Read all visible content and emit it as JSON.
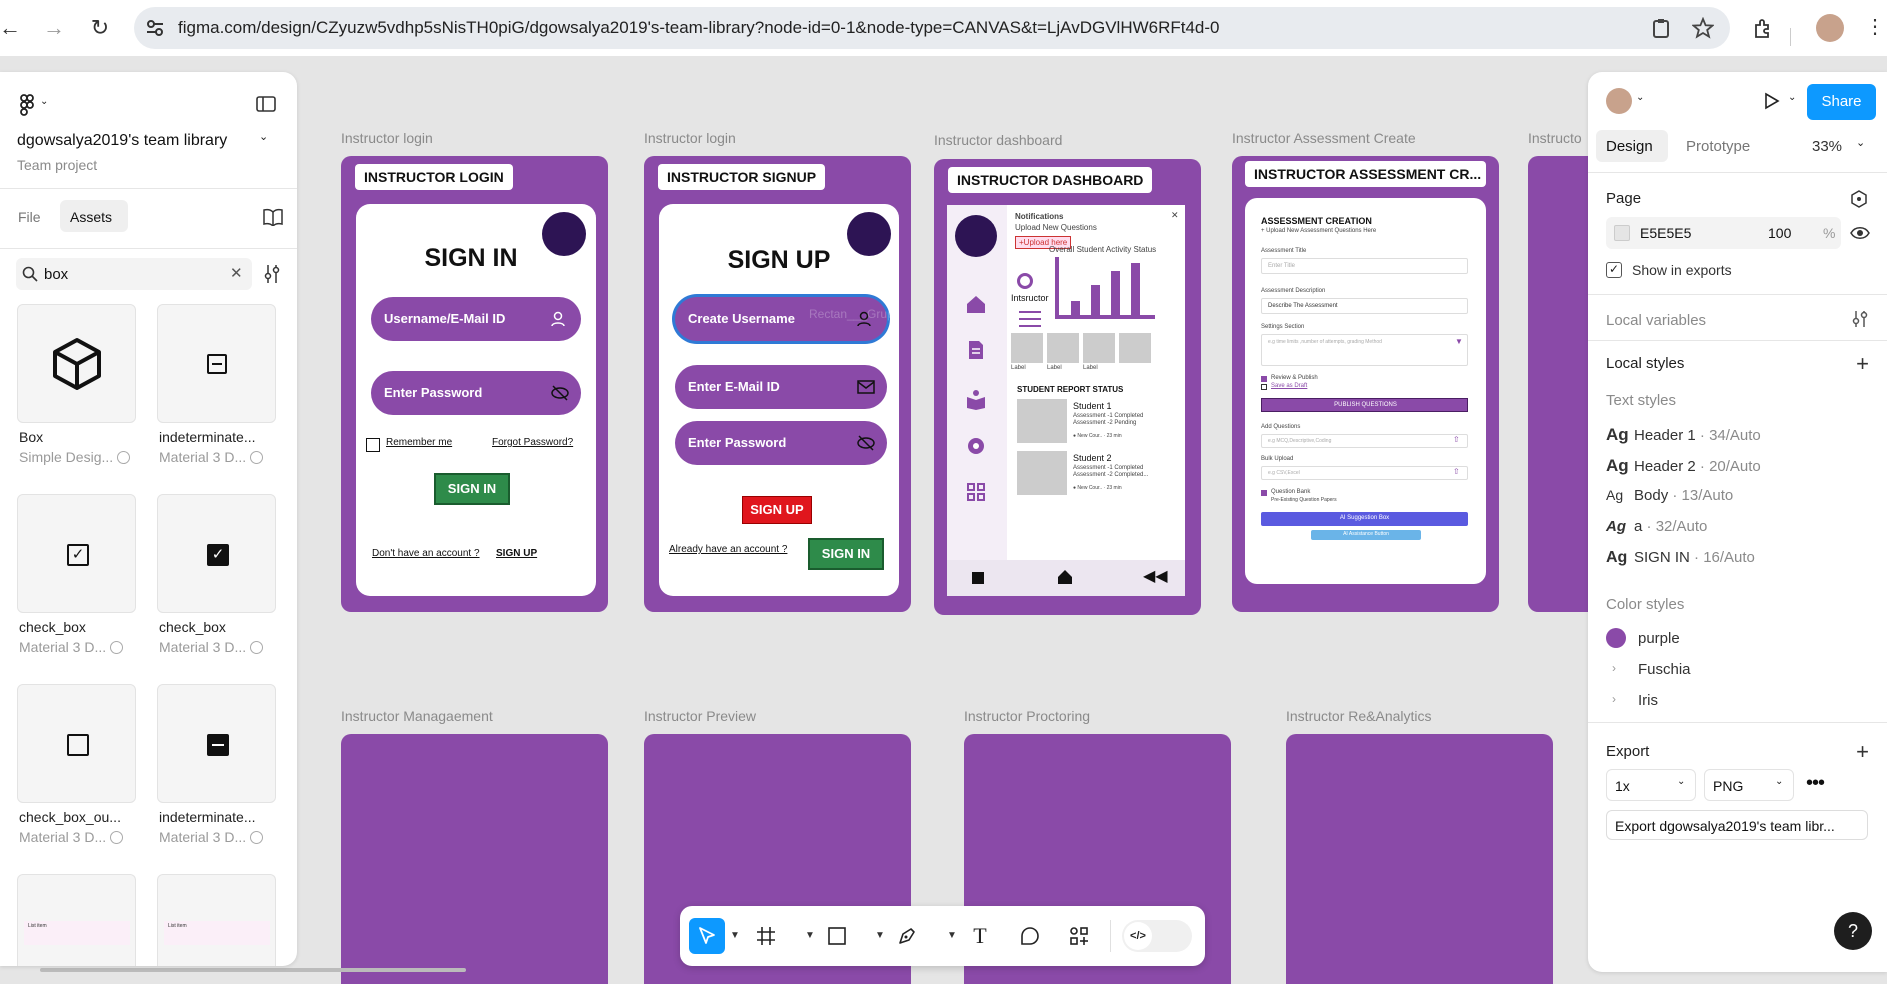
{
  "browser": {
    "url": "figma.com/design/CZyuzw5vdhp5sNisTH0piG/dgowsalya2019's-team-library?node-id=0-1&node-type=CANVAS&t=LjAvDGVlHW6RFt4d-0"
  },
  "left_panel": {
    "team_name": "dgowsalya2019's team library",
    "project_type": "Team project",
    "tabs": [
      "File",
      "Assets"
    ],
    "active_tab": "Assets",
    "search_value": "box",
    "assets": [
      {
        "name": "Box",
        "source": "Simple Desig..."
      },
      {
        "name": "indeterminate...",
        "source": "Material 3 D..."
      },
      {
        "name": "check_box",
        "source": "Material 3 D..."
      },
      {
        "name": "check_box",
        "source": "Material 3 D..."
      },
      {
        "name": "check_box_ou...",
        "source": "Material 3 D..."
      },
      {
        "name": "indeterminate...",
        "source": "Material 3 D..."
      }
    ],
    "list_item_thumb": "List item"
  },
  "canvas": {
    "frame_labels": [
      "Instructor login",
      "Instructor login",
      "Instructor dashboard",
      "Instructor Assessment  Create",
      "Instructo",
      "Instructor Managaement",
      "Instructor Preview",
      "Instructor Proctoring",
      "Instructor Re&Analytics"
    ],
    "login": {
      "title": "INSTRUCTOR LOGIN",
      "heading": "SIGN IN",
      "username": "Username/E-Mail ID",
      "password": "Enter Password",
      "remember": "Remember me",
      "forgot": "Forgot Password?",
      "signin": "SIGN IN",
      "no_account": "Don't have an account ?",
      "signup_link": "SIGN UP"
    },
    "signup": {
      "title": "INSTRUCTOR SIGNUP",
      "heading": "SIGN UP",
      "username": "Create Username",
      "email": "Enter E-Mail ID",
      "password": "Enter Password",
      "signup_btn": "SIGN UP",
      "already": "Already have an account ?",
      "signin_btn": "SIGN IN",
      "ghost": "Rectan___Grup"
    },
    "dashboard": {
      "title": "INSTRUCTOR DASHBOARD",
      "notifications": "Notifications",
      "upload_new": "Upload New Questions",
      "upload_btn": "+Upload here",
      "role": "Intsructor",
      "chart_title": "Overall Student  Activity Status",
      "label": "Label",
      "report_title": "STUDENT REPORT STATUS",
      "student1": "Student 1",
      "s1_line1": "Assessment -1 Completed",
      "s1_line2": "Assessment -2 Pending",
      "student2": "Student 2",
      "s2_line1": "Assessment -1 Completed",
      "s2_line2": "Assessment -2 Completed...",
      "new_course": "New Cour..",
      "mins": "23 min"
    },
    "assessment": {
      "title": "INSTRUCTOR ASSESSMENT CR...",
      "heading": "ASSESSMENT  CREATION",
      "subheading": "+ Upload New Assessment Questions Here",
      "f1_label": "Assessment Title",
      "f1_ph": "Enter Title",
      "f2_label": "Assessment Description",
      "f2_val": "Describe The Assessment",
      "f3_label": "Settings Section",
      "f3_ph": "e.g time limits ,number of attempts, grading Method",
      "review": "Review & Publish",
      "draft": "Save as Draft",
      "publish": "PUBLISH QUESTIONS",
      "add_q": "Add Questions",
      "add_q_ph": "e.g MCQ,Descriptive,Coding",
      "bulk": "Bulk Upload",
      "bulk_ph": "e.g CSV,Excel",
      "qbank": "Question Bank",
      "qbank_sub": "Pre-Existing  Question Papers",
      "ai_box": "AI Suggestion Box",
      "ai_btn": "AI Assistance Button"
    }
  },
  "right_panel": {
    "tabs": [
      "Design",
      "Prototype"
    ],
    "active_tab": "Design",
    "zoom": "33%",
    "share": "Share",
    "page_section": "Page",
    "page_color": "E5E5E5",
    "page_opacity": "100",
    "percent": "%",
    "show_exports": "Show in exports",
    "local_variables": "Local variables",
    "local_styles": "Local styles",
    "text_styles_label": "Text styles",
    "text_styles": [
      {
        "name": "Header 1",
        "meta": "34/Auto"
      },
      {
        "name": "Header 2",
        "meta": "20/Auto"
      },
      {
        "name": "Body",
        "meta": "13/Auto"
      },
      {
        "name": "a",
        "meta": "32/Auto"
      },
      {
        "name": "SIGN IN",
        "meta": "16/Auto"
      }
    ],
    "ag": "Ag",
    "color_styles_label": "Color styles",
    "color_styles": [
      "purple",
      "Fuschia",
      "Iris"
    ],
    "purple_hex": "#8a4aa8",
    "export_label": "Export",
    "export_scale": "1x",
    "export_format": "PNG",
    "export_button": "Export dgowsalya2019's team libr..."
  },
  "toolbar": {
    "tools": [
      "move-tool",
      "frame-tool",
      "shape-tool",
      "pen-tool",
      "text-tool",
      "comment-tool",
      "actions-tool",
      "dev-mode-toggle"
    ]
  },
  "help": "?"
}
